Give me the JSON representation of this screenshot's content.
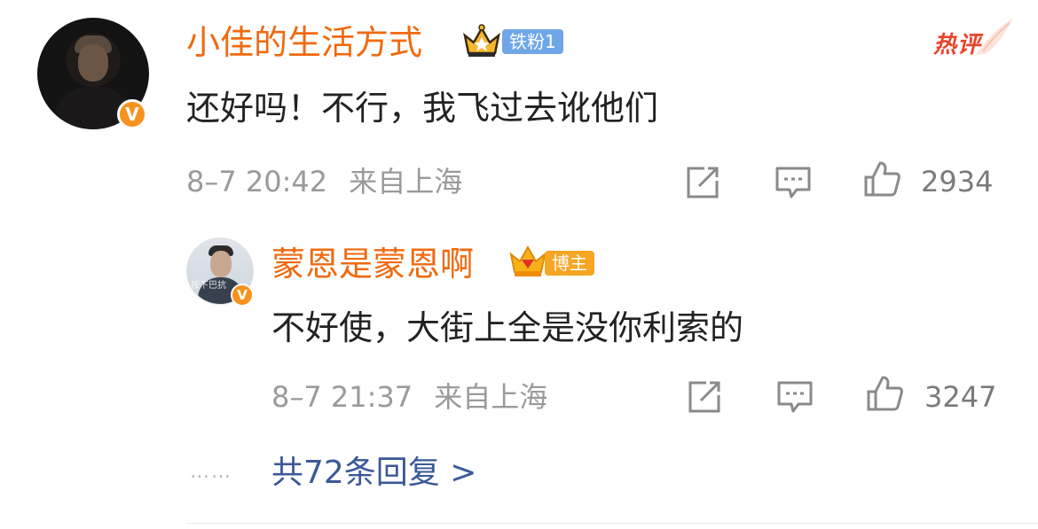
{
  "comment1": {
    "username": "小佳的生活方式",
    "fan_tag": "铁粉1",
    "verified_glyph": "V",
    "hot_label": "热评",
    "content": "还好吗！不行，我飞过去讹他们",
    "date": "8–7 20:42",
    "location": "来自上海",
    "likes": "2934"
  },
  "reply1": {
    "username": "蒙恩是蒙恩啊",
    "role_tag": "博主",
    "verified_glyph": "V",
    "avatar_caption": "按下巴抗",
    "content": "不好使，大街上全是没你利索的",
    "date": "8–7 21:37",
    "location": "来自上海",
    "likes": "3247"
  },
  "replies_summary": {
    "dots": "……",
    "label": "共72条回复 >"
  },
  "colors": {
    "username": "#f06a0f",
    "hot": "#e8432a",
    "link": "#3b5998",
    "badge": "#f7921e",
    "fan_tag": "#6fa6e8"
  },
  "icons": [
    "share-icon",
    "comment-icon",
    "like-icon",
    "crown-icon",
    "verified-icon"
  ]
}
